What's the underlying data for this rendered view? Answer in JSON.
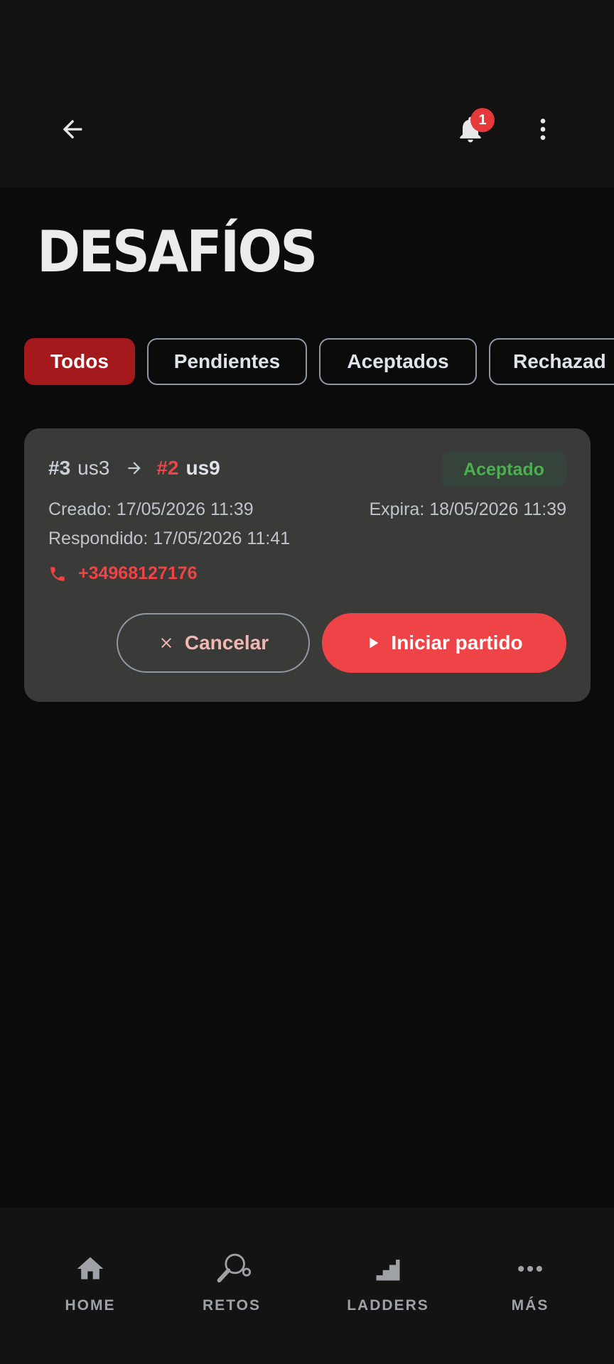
{
  "header": {
    "back_icon": "arrow-left-icon",
    "notifications_icon": "bell-icon",
    "notifications_count": "1",
    "more_icon": "more-vertical-icon"
  },
  "page": {
    "title": "DESAFÍOS"
  },
  "filters": [
    {
      "label": "Todos",
      "active": true
    },
    {
      "label": "Pendientes",
      "active": false
    },
    {
      "label": "Aceptados",
      "active": false
    },
    {
      "label": "Rechazad",
      "active": false
    }
  ],
  "challenge": {
    "challenger_rank": "#3",
    "challenger_name": "us3",
    "challenged_rank": "#2",
    "challenged_name": "us9",
    "status": "Aceptado",
    "created": "Creado: 17/05/2026 11:39",
    "expires": "Expira: 18/05/2026 11:39",
    "responded": "Respondido: 17/05/2026 11:41",
    "phone": "+34968127176",
    "cancel_label": "Cancelar",
    "start_label": "Iniciar partido"
  },
  "bottom_nav": [
    {
      "label": "HOME",
      "icon": "home-icon"
    },
    {
      "label": "RETOS",
      "icon": "table-tennis-icon"
    },
    {
      "label": "LADDERS",
      "icon": "stairs-icon"
    },
    {
      "label": "MÁS",
      "icon": "more-horizontal-icon"
    }
  ],
  "colors": {
    "accent": "#ef4447",
    "accent_dark": "#a3191c",
    "success": "#4caf50",
    "card": "#3a3a39",
    "background": "#0b0b0b"
  }
}
